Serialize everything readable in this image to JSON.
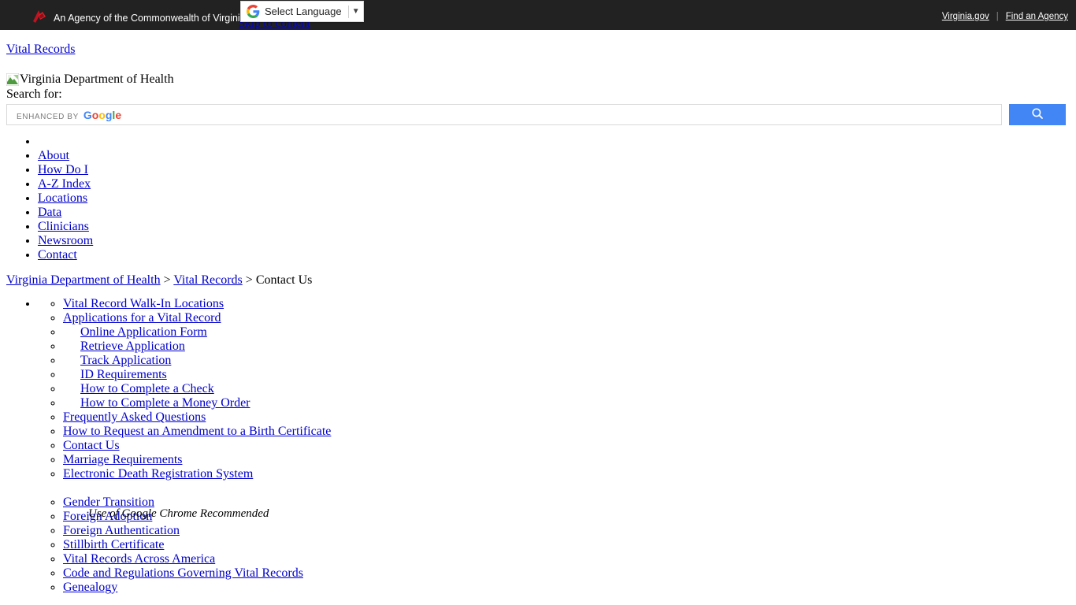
{
  "agency_bar": {
    "logo_icon": "virginia-agency-arrow-icon",
    "text": "An Agency of the Commonwealth of Virginia",
    "links": [
      {
        "label": "Virginia.gov"
      },
      {
        "label": "Find an Agency"
      }
    ],
    "separator": "|",
    "background_color": "#222222"
  },
  "translate_widget": {
    "icon": "google-g-icon",
    "label": "Select Language",
    "caret_icon": "chevron-down-icon"
  },
  "skip_link": {
    "label": "Skip to content"
  },
  "site": {
    "title_link": "Vital Records",
    "logo_alt": "Virginia Department of Health",
    "logo_icon": "broken-image-icon"
  },
  "search": {
    "label": "Search for:",
    "enhanced_by": "Enhanced by",
    "brand": "Google",
    "brand_letters": [
      "G",
      "o",
      "o",
      "g",
      "l",
      "e"
    ],
    "button_icon": "search-icon",
    "button_color": "#4285f4",
    "value": "",
    "placeholder": ""
  },
  "main_nav": {
    "items": [
      {
        "label": ""
      },
      {
        "label": "About"
      },
      {
        "label": "How Do I"
      },
      {
        "label": "A-Z Index"
      },
      {
        "label": "Locations"
      },
      {
        "label": "Data"
      },
      {
        "label": "Clinicians"
      },
      {
        "label": "Newsroom"
      },
      {
        "label": "Contact"
      }
    ]
  },
  "breadcrumb": {
    "items": [
      {
        "label": "Virginia Department of Health",
        "link": true
      },
      {
        "label": "Vital Records",
        "link": true
      },
      {
        "label": "Contact Us",
        "link": false
      }
    ],
    "separator": ">"
  },
  "sidebar": {
    "items": [
      {
        "label": "Vital Record Walk-In Locations",
        "indented": false
      },
      {
        "label": "Applications for a Vital Record",
        "indented": false
      },
      {
        "label": "Online Application Form",
        "indented": true
      },
      {
        "label": "Retrieve Application",
        "indented": true
      },
      {
        "label": "Track Application",
        "indented": true
      },
      {
        "label": "ID Requirements",
        "indented": true
      },
      {
        "label": "How to Complete a Check",
        "indented": true
      },
      {
        "label": "How to Complete a Money Order",
        "indented": true
      },
      {
        "label": "Frequently Asked Questions",
        "indented": false
      },
      {
        "label": "How to Request an Amendment to a Birth Certificate",
        "indented": false
      },
      {
        "label": "Contact Us",
        "indented": false
      },
      {
        "label": "Marriage Requirements",
        "indented": false
      },
      {
        "label": "Electronic Death Registration System",
        "indented": false
      },
      {
        "label": "",
        "indented": false,
        "spacer": true
      },
      {
        "label": "Gender Transition",
        "indented": false
      },
      {
        "label": "Foreign Adoption",
        "indented": false
      },
      {
        "label": "Foreign Authentication",
        "indented": false
      },
      {
        "label": "Stillbirth Certificate",
        "indented": false
      },
      {
        "label": "Vital Records Across America",
        "indented": false
      },
      {
        "label": "Code and Regulations Governing Vital Records",
        "indented": false
      },
      {
        "label": "Genealogy",
        "indented": false
      }
    ],
    "edrs_note": "Use of Google Chrome Recommended"
  }
}
